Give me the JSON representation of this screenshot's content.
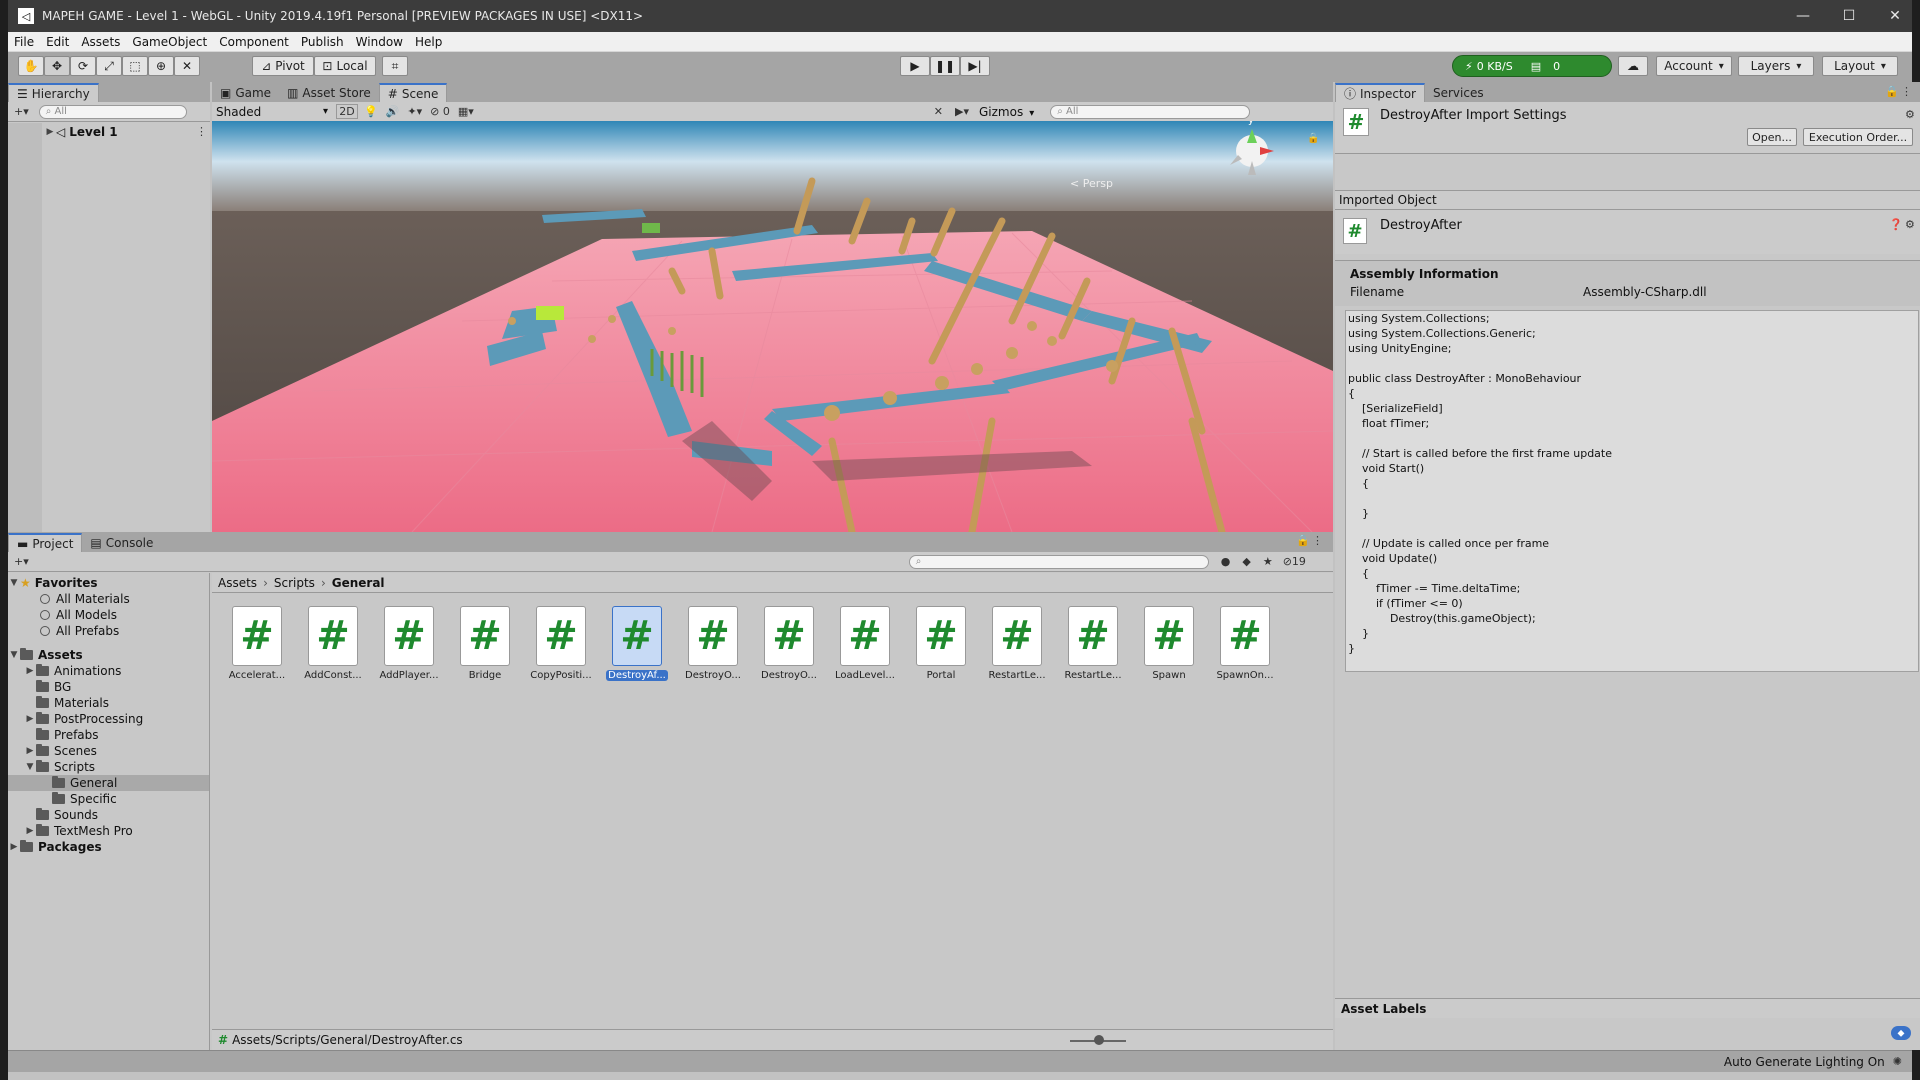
{
  "window": {
    "title": "MAPEH GAME - Level 1 - WebGL - Unity 2019.4.19f1 Personal [PREVIEW PACKAGES IN USE] <DX11>",
    "controls": {
      "minimize": "—",
      "maximize": "☐",
      "close": "✕"
    }
  },
  "menu": [
    "File",
    "Edit",
    "Assets",
    "GameObject",
    "Component",
    "Publish",
    "Window",
    "Help"
  ],
  "toolbar": {
    "pivot": "Pivot",
    "local": "Local",
    "collab_speed": "0 KB/S",
    "collab_count": "0",
    "account": "Account",
    "layers": "Layers",
    "layout": "Layout"
  },
  "hierarchy": {
    "tab": "Hierarchy",
    "search_placeholder": "All",
    "root": "Level 1"
  },
  "scene_view": {
    "tabs": [
      "Game",
      "Asset Store",
      "Scene"
    ],
    "shading": "Shaded",
    "mode_2d": "2D",
    "hidden_count": "0",
    "gizmos": "Gizmos",
    "search_placeholder": "All",
    "persp": "Persp",
    "axis_y": "y",
    "colors": {
      "ground": "#f07a94",
      "track": "#5c9ab8",
      "posts": "#c49a58",
      "sky": "#cfe2ee"
    }
  },
  "project": {
    "tabs": [
      "Project",
      "Console"
    ],
    "favorites_label": "Favorites",
    "favorites": [
      "All Materials",
      "All Models",
      "All Prefabs"
    ],
    "assets_label": "Assets",
    "asset_folders": [
      {
        "name": "Animations",
        "expandable": true
      },
      {
        "name": "BG",
        "expandable": false
      },
      {
        "name": "Materials",
        "expandable": false
      },
      {
        "name": "PostProcessing",
        "expandable": true
      },
      {
        "name": "Prefabs",
        "expandable": false
      },
      {
        "name": "Scenes",
        "expandable": true
      },
      {
        "name": "Scripts",
        "expandable": true
      }
    ],
    "script_subfolders": [
      "General",
      "Specific"
    ],
    "more_folders": [
      "Sounds",
      "TextMesh Pro"
    ],
    "packages_label": "Packages",
    "breadcrumb": [
      "Assets",
      "Scripts",
      "General"
    ],
    "hidden_count": "19",
    "assets": [
      "Accelerat...",
      "AddConst...",
      "AddPlayer...",
      "Bridge",
      "CopyPositi...",
      "DestroyAf...",
      "DestroyO...",
      "DestroyO...",
      "LoadLevel...",
      "Portal",
      "RestartLe...",
      "RestartLe...",
      "Spawn",
      "SpawnOn..."
    ],
    "selected_asset": "DestroyAf...",
    "footer_path": "Assets/Scripts/General/DestroyAfter.cs"
  },
  "inspector": {
    "tabs": [
      "Inspector",
      "Services"
    ],
    "header_title": "DestroyAfter Import Settings",
    "open_button": "Open...",
    "execution_order_button": "Execution Order...",
    "imported_object_label": "Imported Object",
    "object_name": "DestroyAfter",
    "assembly_info_label": "Assembly Information",
    "filename_label": "Filename",
    "filename_value": "Assembly-CSharp.dll",
    "code": "using System.Collections;\nusing System.Collections.Generic;\nusing UnityEngine;\n\npublic class DestroyAfter : MonoBehaviour\n{\n    [SerializeField]\n    float fTimer;\n\n    // Start is called before the first frame update\n    void Start()\n    {\n\n    }\n\n    // Update is called once per frame\n    void Update()\n    {\n        fTimer -= Time.deltaTime;\n        if (fTimer <= 0)\n            Destroy(this.gameObject);\n    }\n}",
    "asset_labels": "Asset Labels"
  },
  "status": {
    "lighting": "Auto Generate Lighting On"
  }
}
